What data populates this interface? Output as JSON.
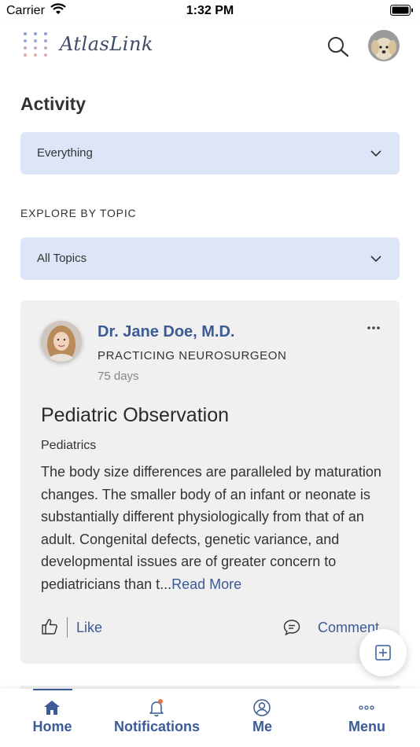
{
  "status_bar": {
    "carrier": "Carrier",
    "time": "1:32 PM"
  },
  "header": {
    "app_name": "AtlasLink",
    "search_icon": "search-icon",
    "avatar": "user-avatar-dog"
  },
  "activity": {
    "title": "Activity",
    "filter": {
      "selected": "Everything"
    }
  },
  "explore": {
    "label": "EXPLORE BY TOPIC",
    "topic": {
      "selected": "All Topics"
    }
  },
  "post": {
    "author_name": "Dr. Jane Doe, M.D.",
    "author_title": "PRACTICING NEUROSURGEON",
    "age": "75 days",
    "title": "Pediatric Observation",
    "topic": "Pediatrics",
    "body": "The body size differences are paralleled by maturation changes. The smaller body of an infant or neonate is substantially different physiologically from that of an adult. Congenital defects, genetic variance, and developmental issues are of greater concern to pediatricians than t...",
    "read_more": "Read More",
    "like_label": "Like",
    "comment_label": "Comment"
  },
  "tabs": [
    {
      "label": "Home",
      "icon": "home-icon"
    },
    {
      "label": "Notifications",
      "icon": "bell-icon"
    },
    {
      "label": "Me",
      "icon": "profile-icon"
    },
    {
      "label": "Menu",
      "icon": "more-dots-icon"
    }
  ],
  "colors": {
    "accent": "#3b5a96",
    "dropdown_bg": "#dde6f8",
    "card_bg": "#f0f0f0",
    "notification_dot": "#e8734a"
  }
}
